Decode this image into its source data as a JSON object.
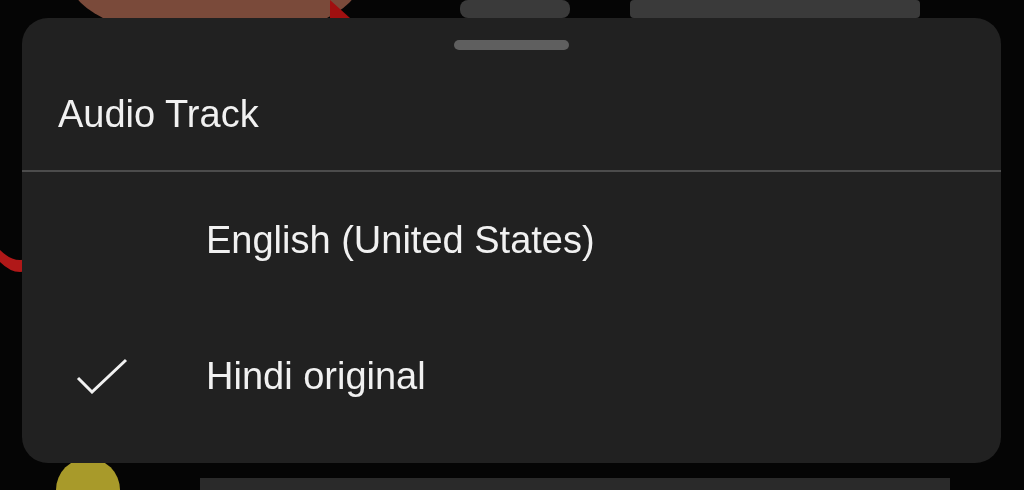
{
  "sheet": {
    "title": "Audio Track",
    "options": [
      {
        "label": "English (United States)",
        "selected": false
      },
      {
        "label": "Hindi original",
        "selected": true
      }
    ]
  }
}
